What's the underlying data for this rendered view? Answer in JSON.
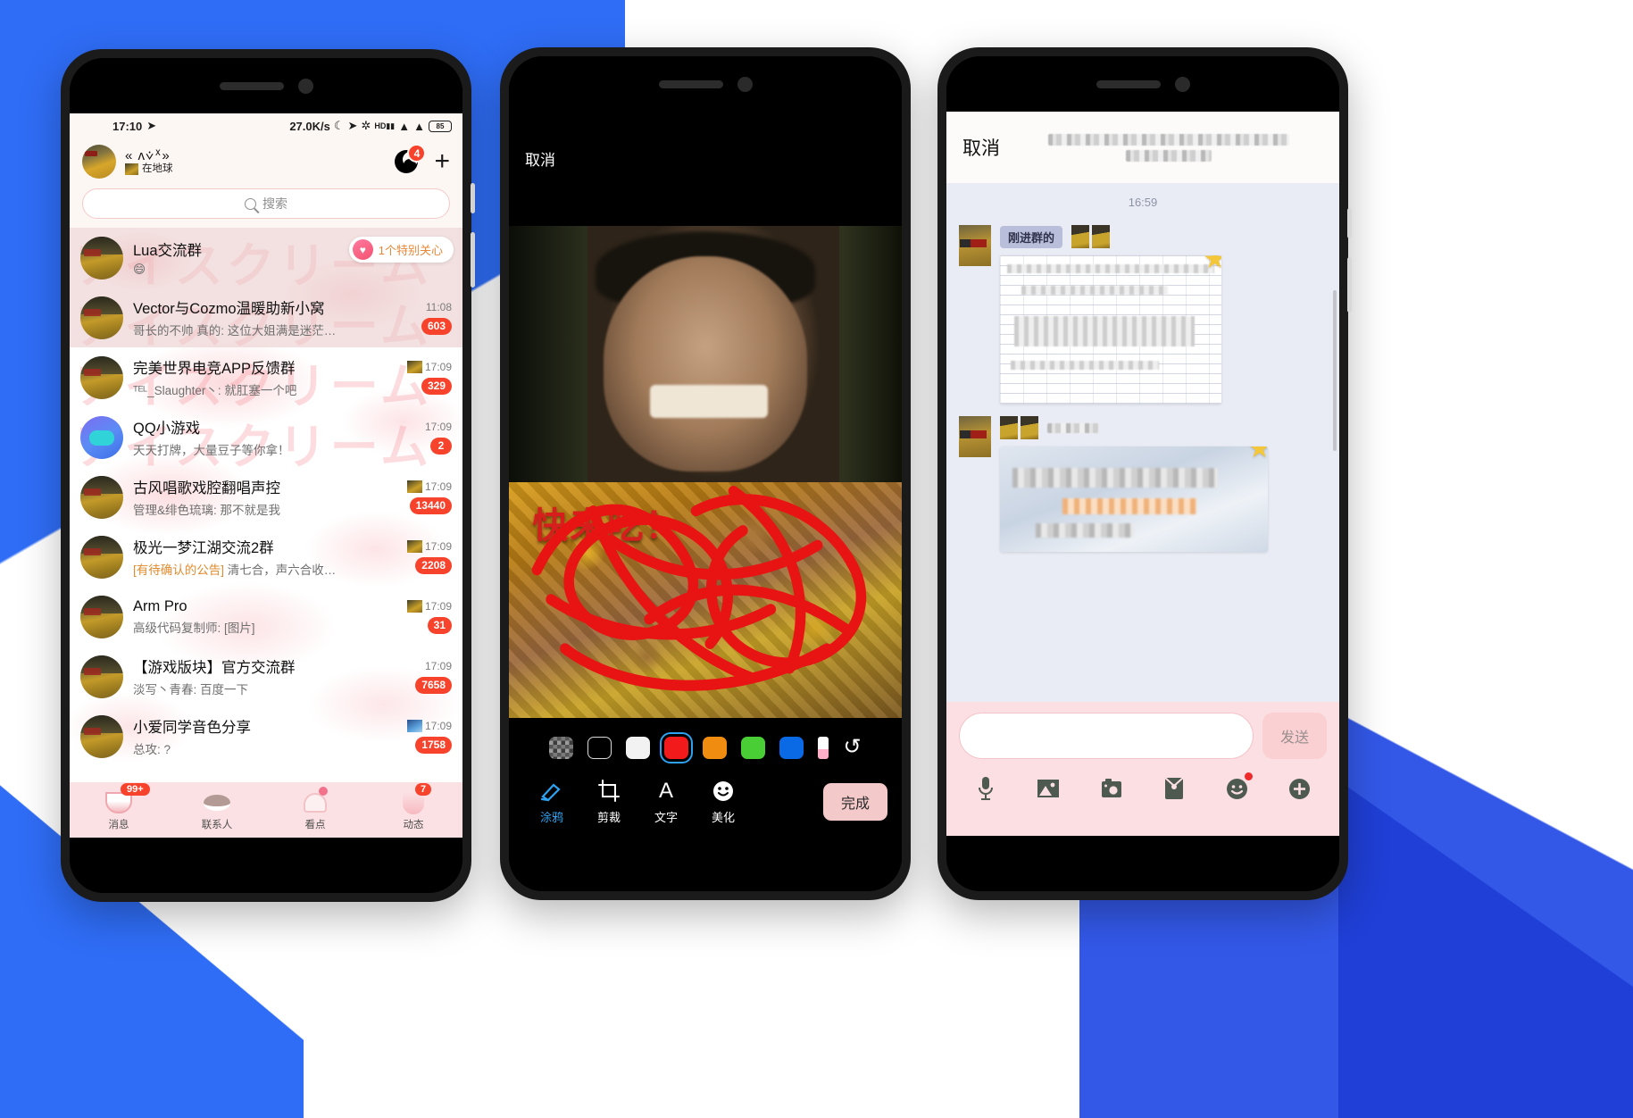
{
  "phone1": {
    "status_bar": {
      "time": "17:10",
      "network_speed": "27.0K/s",
      "battery": "85"
    },
    "header": {
      "nickname": "« ʌ⩒ᕁ»",
      "subtitle": "在地球",
      "qzone_badge": "4",
      "plus_label": "+"
    },
    "search": {
      "placeholder": "搜索"
    },
    "special_care_pill": "1个特别关心",
    "chats": [
      {
        "title": "Lua交流群",
        "snippet": "😄",
        "time": "",
        "unread": "",
        "selected": true,
        "avatar": "group",
        "has_thumb": false
      },
      {
        "title": "Vector与Cozmo温暖助新小窝",
        "snippet": "哥长的不帅  真的: 这位大姐满是迷茫…",
        "time": "11:08",
        "unread": "603",
        "selected": true,
        "avatar": "group",
        "has_thumb": false
      },
      {
        "title": "完美世界电竞APP反馈群",
        "snippet": "ᵀᴱᴸ_Slaughter丶: 就肛塞一个吧",
        "time": "17:09",
        "unread": "329",
        "selected": false,
        "avatar": "group",
        "has_thumb": true
      },
      {
        "title": "QQ小游戏",
        "snippet": "天天打牌，大量豆子等你拿！",
        "time": "17:09",
        "unread": "2",
        "selected": false,
        "avatar": "game",
        "has_thumb": false
      },
      {
        "title": "古风唱歌戏腔翻唱声控",
        "snippet": "管理&绯色琉璃: 那不就是我",
        "time": "17:09",
        "unread": "13440",
        "selected": false,
        "avatar": "group",
        "has_thumb": true
      },
      {
        "title": "极光一梦江湖交流2群",
        "snippet_hl": "[有待确认的公告]",
        "snippet": " 清七合，声六合收…",
        "time": "17:09",
        "unread": "2208",
        "selected": false,
        "avatar": "group",
        "has_thumb": true
      },
      {
        "title": "Arm Pro",
        "snippet": "高级代码复制师: [图片]",
        "time": "17:09",
        "unread": "31",
        "selected": false,
        "avatar": "group",
        "has_thumb": true
      },
      {
        "title": "【游戏版块】官方交流群",
        "snippet": "淡写丶青春: 百度一下",
        "time": "17:09",
        "unread": "7658",
        "selected": false,
        "avatar": "group",
        "has_thumb": false
      },
      {
        "title": "小爱同学音色分享",
        "snippet": "总攻: ?",
        "time": "17:09",
        "unread": "1758",
        "selected": false,
        "avatar": "group",
        "has_thumb": true
      }
    ],
    "tabs": [
      {
        "label": "消息",
        "badge": "99+",
        "icon": "message-icon",
        "active": true
      },
      {
        "label": "联系人",
        "badge": "",
        "icon": "contacts-icon",
        "active": false
      },
      {
        "label": "看点",
        "badge": "",
        "icon": "watchpoint-icon",
        "active": false
      },
      {
        "label": "动态",
        "badge": "7",
        "icon": "moments-icon",
        "active": false
      }
    ]
  },
  "phone2": {
    "cancel_label": "取消",
    "caption": "快来吃！",
    "swatches": [
      {
        "name": "mosaic",
        "color": "mosaic",
        "selected": false
      },
      {
        "name": "black",
        "color": "#000000",
        "selected": false
      },
      {
        "name": "white",
        "color": "#f2f2f2",
        "selected": false
      },
      {
        "name": "red",
        "color": "#f21a1a",
        "selected": true
      },
      {
        "name": "orange",
        "color": "#f08c10",
        "selected": false
      },
      {
        "name": "green",
        "color": "#49ce35",
        "selected": false
      },
      {
        "name": "blue",
        "color": "#0a6ae6",
        "selected": false
      }
    ],
    "eraser_name": "eraser",
    "undo_glyph": "↺",
    "tools": [
      {
        "label": "涂鸦",
        "icon": "doodle-pen-icon",
        "active": true
      },
      {
        "label": "剪裁",
        "icon": "crop-icon",
        "active": false
      },
      {
        "label": "文字",
        "icon": "text-icon",
        "active": false
      },
      {
        "label": "美化",
        "icon": "beautify-sticker-icon",
        "active": false
      }
    ],
    "done_label": "完成"
  },
  "phone3": {
    "cancel_label": "取消",
    "timestamp": "16:59",
    "messages": [
      {
        "name_chip": "刚进群的",
        "kind": "doc"
      },
      {
        "name_chip": "",
        "kind": "image"
      }
    ],
    "input_placeholder": "",
    "send_label": "发送",
    "toolbar_icons": [
      {
        "name": "microphone-icon",
        "dot": false
      },
      {
        "name": "gallery-icon",
        "dot": false
      },
      {
        "name": "camera-icon",
        "dot": false
      },
      {
        "name": "red-envelope-icon",
        "dot": false
      },
      {
        "name": "emoji-icon",
        "dot": true
      },
      {
        "name": "plus-more-icon",
        "dot": false
      }
    ]
  }
}
